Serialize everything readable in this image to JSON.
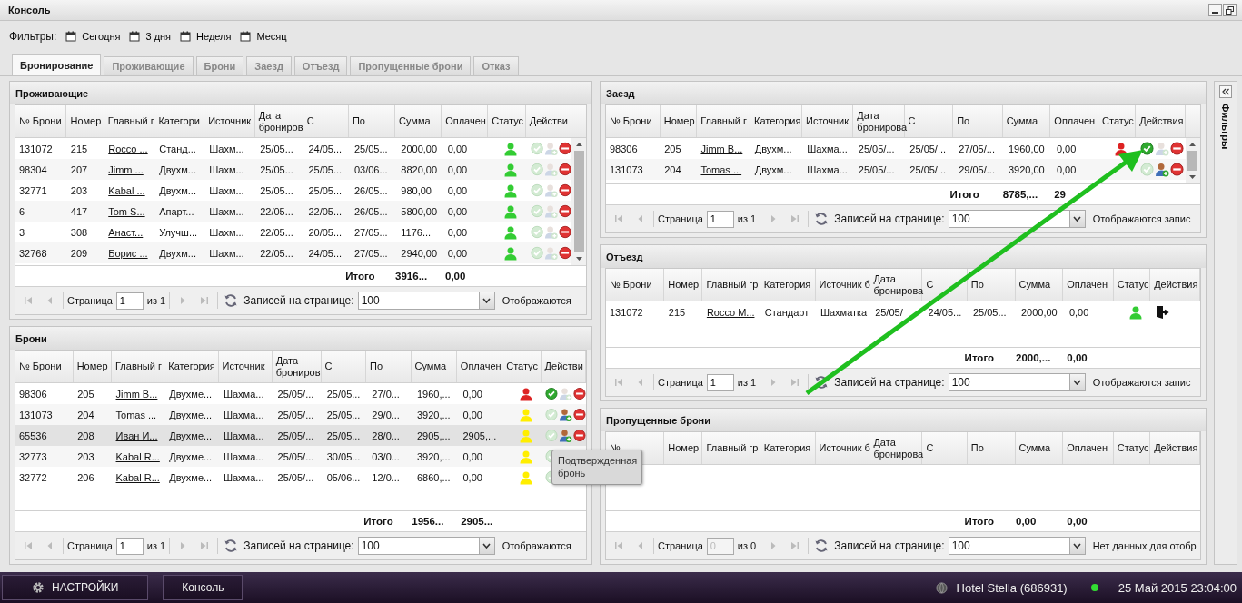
{
  "window": {
    "title": "Консоль"
  },
  "filters": {
    "label": "Фильтры:",
    "items": [
      "Сегодня",
      "3 дня",
      "Неделя",
      "Месяц"
    ]
  },
  "tabs": [
    {
      "label": "Бронирование",
      "selected": true
    },
    {
      "label": "Проживающие",
      "selected": false
    },
    {
      "label": "Брони",
      "selected": false
    },
    {
      "label": "Заезд",
      "selected": false
    },
    {
      "label": "Отъезд",
      "selected": false
    },
    {
      "label": "Пропущенные брони",
      "selected": false
    },
    {
      "label": "Отказ",
      "selected": false
    }
  ],
  "left_panels": [
    {
      "title": "Проживающие",
      "scrollable": true,
      "columns": [
        "№ Брони",
        "Номер",
        "Главный г",
        "Категори",
        "Источник",
        "Дата брониров",
        "С",
        "По",
        "Сумма",
        "Оплачен",
        "Статус",
        "Действи"
      ],
      "rows": [
        {
          "selected": false,
          "color": "#33cc33",
          "cells": [
            "131072",
            "215",
            "Rocco ...",
            "Станд...",
            "Шахм...",
            "25/05...",
            "24/05...",
            "25/05...",
            "2000,00",
            "0,00"
          ],
          "actions": [
            {
              "kind": "confirm",
              "enabled": false
            },
            {
              "kind": "checkin",
              "enabled": false
            },
            {
              "kind": "cancel",
              "enabled": true
            }
          ]
        },
        {
          "selected": false,
          "color": "#33cc33",
          "cells": [
            "98304",
            "207",
            "Jimm ...",
            "Двухм...",
            "Шахм...",
            "25/05...",
            "25/05...",
            "03/06...",
            "8820,00",
            "0,00"
          ],
          "actions": [
            {
              "kind": "confirm",
              "enabled": false
            },
            {
              "kind": "checkin",
              "enabled": false
            },
            {
              "kind": "cancel",
              "enabled": true
            }
          ]
        },
        {
          "selected": false,
          "color": "#33cc33",
          "cells": [
            "32771",
            "203",
            "Kabal ...",
            "Двухм...",
            "Шахм...",
            "25/05...",
            "25/05...",
            "26/05...",
            "980,00",
            "0,00"
          ],
          "actions": [
            {
              "kind": "confirm",
              "enabled": false
            },
            {
              "kind": "checkin",
              "enabled": false
            },
            {
              "kind": "cancel",
              "enabled": true
            }
          ]
        },
        {
          "selected": false,
          "color": "#33cc33",
          "cells": [
            "6",
            "417",
            "Tom S...",
            "Апарт...",
            "Шахм...",
            "22/05...",
            "22/05...",
            "26/05...",
            "5800,00",
            "0,00"
          ],
          "actions": [
            {
              "kind": "confirm",
              "enabled": false
            },
            {
              "kind": "checkin",
              "enabled": false
            },
            {
              "kind": "cancel",
              "enabled": true
            }
          ]
        },
        {
          "selected": false,
          "color": "#33cc33",
          "cells": [
            "3",
            "308",
            "Анаст...",
            "Улучш...",
            "Шахм...",
            "22/05...",
            "20/05...",
            "27/05...",
            "1176...",
            "0,00"
          ],
          "actions": [
            {
              "kind": "confirm",
              "enabled": false
            },
            {
              "kind": "checkin",
              "enabled": false
            },
            {
              "kind": "cancel",
              "enabled": true
            }
          ]
        },
        {
          "selected": false,
          "color": "#33cc33",
          "cells": [
            "32768",
            "209",
            "Борис ...",
            "Двухм...",
            "Шахм...",
            "22/05...",
            "24/05...",
            "27/05...",
            "2940,00",
            "0,00"
          ],
          "actions": [
            {
              "kind": "confirm",
              "enabled": false
            },
            {
              "kind": "checkin",
              "enabled": false
            },
            {
              "kind": "cancel",
              "enabled": true
            }
          ]
        }
      ],
      "totals": {
        "label": "Итого",
        "sum": "3916...",
        "paid": "0,00"
      },
      "pager": {
        "page_label": "Страница",
        "page": "1",
        "page_disabled": false,
        "of": "из 1",
        "per_page_label": "Записей на странице:",
        "per_page": "100",
        "info": "Отображаются"
      }
    },
    {
      "title": "Брони",
      "scrollable": false,
      "columns": [
        "№ Брони",
        "Номер",
        "Главный г",
        "Категория",
        "Источник",
        "Дата брониров",
        "С",
        "По",
        "Сумма",
        "Оплачен",
        "Статус",
        "Действи"
      ],
      "rows": [
        {
          "selected": false,
          "color": "#dd2222",
          "cells": [
            "98306",
            "205",
            "Jimm B...",
            "Двухме...",
            "Шахма...",
            "25/05/...",
            "25/05...",
            "27/0...",
            "1960,...",
            "0,00"
          ],
          "actions": [
            {
              "kind": "confirm",
              "enabled": true
            },
            {
              "kind": "checkin",
              "enabled": false
            },
            {
              "kind": "cancel",
              "enabled": true
            }
          ]
        },
        {
          "selected": false,
          "color": "#ffee00",
          "cells": [
            "131073",
            "204",
            "Tomas ...",
            "Двухме...",
            "Шахма...",
            "25/05/...",
            "25/05...",
            "29/0...",
            "3920,...",
            "0,00"
          ],
          "actions": [
            {
              "kind": "confirm",
              "enabled": false
            },
            {
              "kind": "checkin",
              "enabled": true
            },
            {
              "kind": "cancel",
              "enabled": true
            }
          ]
        },
        {
          "selected": true,
          "color": "#ffee00",
          "cells": [
            "65536",
            "208",
            "Иван И...",
            "Двухме...",
            "Шахма...",
            "25/05/...",
            "25/05...",
            "28/0...",
            "2905,...",
            "2905,..."
          ],
          "actions": [
            {
              "kind": "confirm",
              "enabled": false
            },
            {
              "kind": "checkin",
              "enabled": true
            },
            {
              "kind": "cancel",
              "enabled": true
            }
          ]
        },
        {
          "selected": false,
          "color": "#ffee00",
          "cells": [
            "32773",
            "203",
            "Kabal R...",
            "Двухме...",
            "Шахма...",
            "25/05/...",
            "30/05...",
            "03/0...",
            "3920,...",
            "0,00"
          ],
          "actions": [
            {
              "kind": "confirm",
              "enabled": false
            }
          ]
        },
        {
          "selected": false,
          "color": "#ffee00",
          "cells": [
            "32772",
            "206",
            "Kabal R...",
            "Двухме...",
            "Шахма...",
            "25/05/...",
            "05/06...",
            "12/0...",
            "6860,...",
            "0,00"
          ],
          "actions": [
            {
              "kind": "confirm",
              "enabled": false
            }
          ]
        }
      ],
      "totals": {
        "label": "Итого",
        "sum": "1956...",
        "paid": "2905..."
      },
      "pager": {
        "page_label": "Страница",
        "page": "1",
        "page_disabled": false,
        "of": "из 1",
        "per_page_label": "Записей на странице:",
        "per_page": "100",
        "info": "Отображаются"
      }
    }
  ],
  "right_panels": [
    {
      "title": "Заезд",
      "scrollable": true,
      "columns": [
        "№ Брони",
        "Номер",
        "Главный г",
        "Категория",
        "Источник",
        "Дата бронирова",
        "С",
        "По",
        "Сумма",
        "Оплачен",
        "Статус",
        "Действия"
      ],
      "rows": [
        {
          "selected": false,
          "color": "#dd2222",
          "cells": [
            "98306",
            "205",
            "Jimm B...",
            "Двухм...",
            "Шахма...",
            "25/05/...",
            "25/05/...",
            "27/05/...",
            "1960,00",
            "0,00"
          ],
          "actions": [
            {
              "kind": "confirm",
              "enabled": true
            },
            {
              "kind": "checkin",
              "enabled": false
            },
            {
              "kind": "cancel",
              "enabled": true
            }
          ]
        },
        {
          "selected": false,
          "cells": [
            "131073",
            "204",
            "Tomas ...",
            "Двухм...",
            "Шахма...",
            "25/05/...",
            "25/05/...",
            "29/05/...",
            "3920,00",
            "0,00"
          ],
          "actions": [
            {
              "kind": "confirm",
              "enabled": false
            },
            {
              "kind": "checkin",
              "enabled": true
            },
            {
              "kind": "cancel",
              "enabled": true
            }
          ]
        }
      ],
      "totals": {
        "label": "Итого",
        "sum": "8785,...",
        "paid": "29"
      },
      "pager": {
        "page_label": "Страница",
        "page": "1",
        "page_disabled": false,
        "of": "из 1",
        "per_page_label": "Записей на странице:",
        "per_page": "100",
        "info": "Отображаются запис"
      }
    },
    {
      "title": "Отъезд",
      "scrollable": false,
      "columns": [
        "№ Брони",
        "Номер",
        "Главный гр",
        "Категория",
        "Источник б",
        "Дата бронирова",
        "С",
        "По",
        "Сумма",
        "Оплачен",
        "Статус",
        "Действия"
      ],
      "rows": [
        {
          "selected": false,
          "color": "#33cc33",
          "cells": [
            "131072",
            "215",
            "Rocco M...",
            "Стандарт",
            "Шахматка",
            "25/05/",
            "24/05...",
            "25/05...",
            "2000,00",
            "0,00"
          ],
          "actions": [
            {
              "kind": "checkout",
              "enabled": true
            }
          ]
        }
      ],
      "totals": {
        "label": "Итого",
        "sum": "2000,...",
        "paid": "0,00"
      },
      "pager": {
        "page_label": "Страница",
        "page": "1",
        "page_disabled": false,
        "of": "из 1",
        "per_page_label": "Записей на странице:",
        "per_page": "100",
        "info": "Отображаются запис"
      }
    },
    {
      "title": "Пропущенные брони",
      "scrollable": false,
      "columns": [
        "№",
        "Номер",
        "Главный гр",
        "Категория",
        "Источник б",
        "Дата бронирова",
        "С",
        "По",
        "Сумма",
        "Оплачен",
        "Статус",
        "Действия"
      ],
      "totals": {
        "label": "Итого",
        "sum": "0,00",
        "paid": "0,00"
      },
      "pager": {
        "page_label": "Страница",
        "page": "0",
        "page_disabled": true,
        "of": "из 0",
        "per_page_label": "Записей на странице:",
        "per_page": "100",
        "info": "Нет данных для отобр"
      }
    }
  ],
  "side_panel": {
    "label": "Фильтры"
  },
  "tooltip": "Подтвержденная бронь",
  "taskbar": {
    "settings": "НАСТРОЙКИ",
    "console": "Консоль",
    "hotel": "Hotel Stella (686931)",
    "online": true,
    "datetime": "25 Май 2015 23:04:00"
  }
}
